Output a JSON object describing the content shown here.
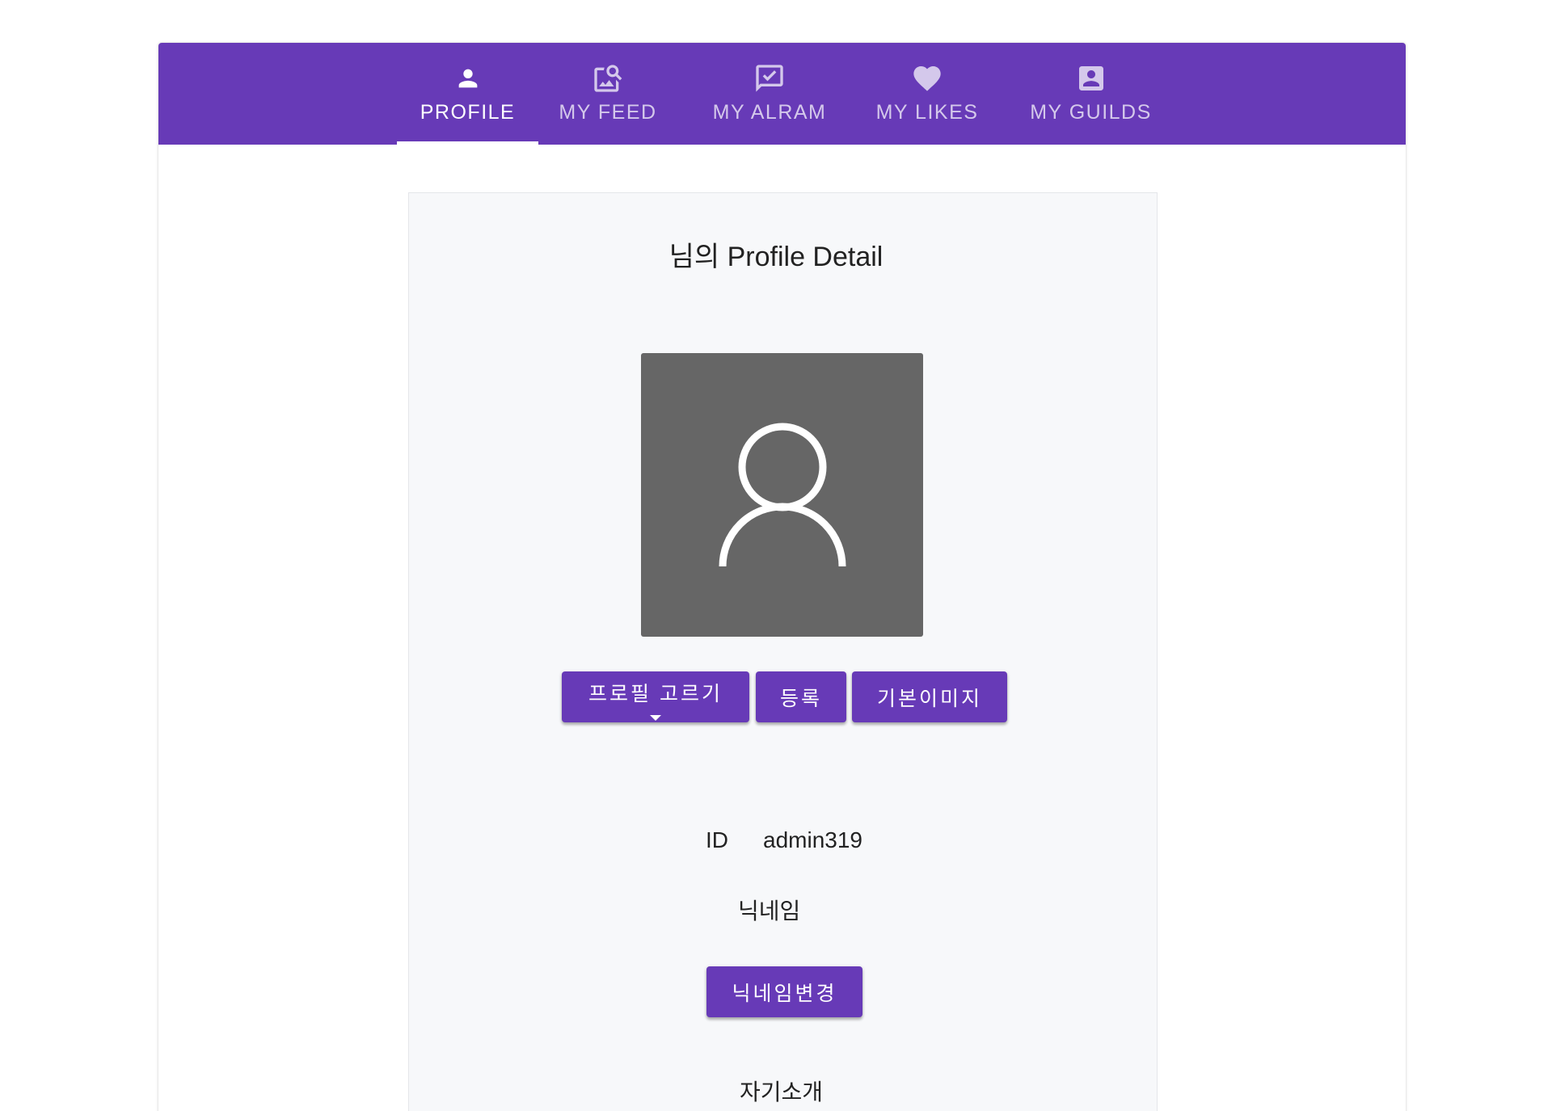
{
  "tabs": [
    {
      "label": "PROFILE",
      "icon": "person-icon",
      "active": true
    },
    {
      "label": "MY FEED",
      "icon": "feed-search-icon",
      "active": false
    },
    {
      "label": "MY ALRAM",
      "icon": "chat-check-icon",
      "active": false
    },
    {
      "label": "MY LIKES",
      "icon": "heart-icon",
      "active": false
    },
    {
      "label": "MY GUILDS",
      "icon": "account-box-icon",
      "active": false
    }
  ],
  "profile": {
    "title": "님의 Profile Detail",
    "avatar_icon": "user-outline-icon",
    "select_label": "프로필 고르기",
    "register_label": "등록",
    "default_image_label": "기본이미지",
    "id_label": "ID",
    "id_value": "admin319",
    "nickname_label": "닉네임",
    "nickname_button": "닉네임변경",
    "intro_label": "자기소개"
  },
  "colors": {
    "primary": "#673ab7",
    "avatar_bg": "#666666",
    "panel_bg": "#f7f8fa"
  }
}
